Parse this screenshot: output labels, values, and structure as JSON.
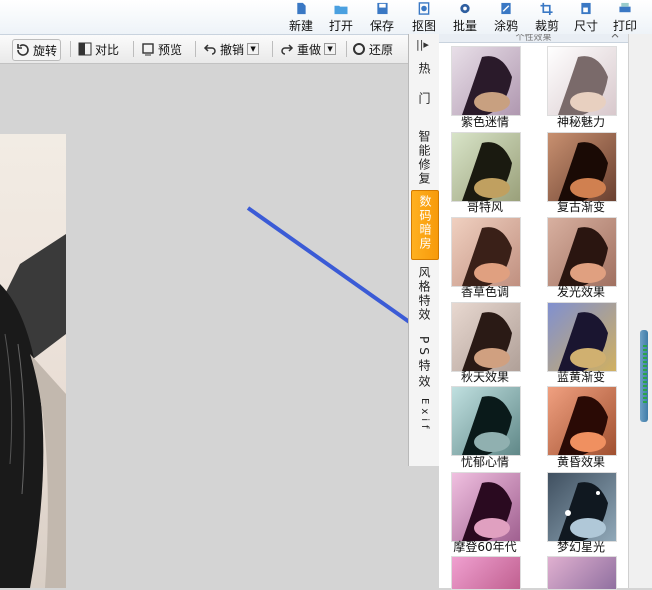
{
  "topbar": {
    "items": [
      {
        "label": "新建"
      },
      {
        "label": "打开"
      },
      {
        "label": "保存"
      },
      {
        "label": "抠图"
      },
      {
        "label": "批量"
      },
      {
        "label": "涂鸦"
      },
      {
        "label": "裁剪"
      },
      {
        "label": "尺寸"
      },
      {
        "label": "打印"
      }
    ]
  },
  "toolbar": {
    "rotate": "旋转",
    "compare": "对比",
    "preview": "预览",
    "undo": "撤销",
    "redo": "重做",
    "restore": "还原"
  },
  "tabs": [
    {
      "label": "热门"
    },
    {
      "label": "智能修复"
    },
    {
      "label": "数码暗房"
    },
    {
      "label": "风格特效"
    },
    {
      "label": "PS特效"
    },
    {
      "label": "Exif"
    }
  ],
  "panel": {
    "header": "个性效果",
    "effects": [
      {
        "label": "紫色迷情"
      },
      {
        "label": "神秘魅力"
      },
      {
        "label": "哥特风"
      },
      {
        "label": "复古渐变"
      },
      {
        "label": "香草色调"
      },
      {
        "label": "发光效果"
      },
      {
        "label": "秋天效果"
      },
      {
        "label": "蓝黄渐变"
      },
      {
        "label": "忧郁心情"
      },
      {
        "label": "黄昏效果"
      },
      {
        "label": "摩登60年代"
      },
      {
        "label": "梦幻星光"
      }
    ]
  },
  "colors": {
    "arrow": "#3b5bd6",
    "active_tab": "#f79a0a"
  }
}
